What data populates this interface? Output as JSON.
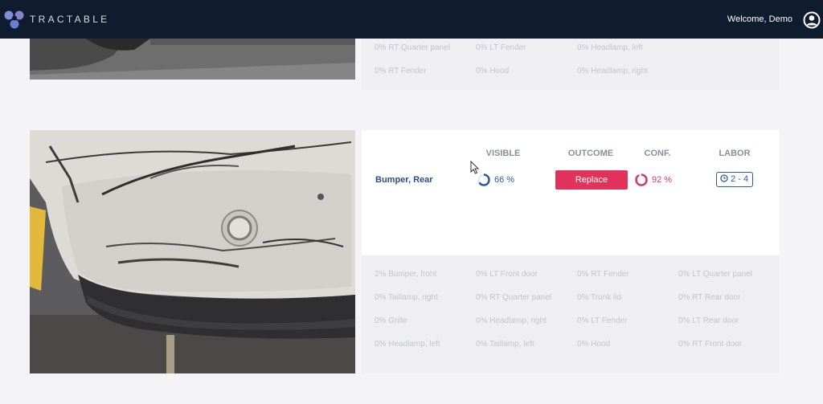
{
  "header": {
    "brand": "TRACTABLE",
    "welcome": "Welcome, Demo"
  },
  "card1": {
    "other_parts": [
      [
        "0% RT Quarter panel",
        "0% LT Fender",
        "0% Headlamp, left"
      ],
      [
        "0% RT Fender",
        "0% Hood",
        "0% Headlamp, right"
      ]
    ]
  },
  "card2": {
    "columns": {
      "visible": "VISIBLE",
      "outcome": "OUTCOME",
      "conf": "CONF.",
      "labor": "LABOR"
    },
    "part": "Bumper, Rear",
    "visible_pct": "66 %",
    "visible_value": 0.66,
    "outcome": "Replace",
    "conf_pct": "92 %",
    "conf_value": 0.92,
    "labor": "2 - 4",
    "other_parts": [
      [
        "2% Bumper, front",
        "0% LT Front door",
        "0% RT Fender",
        "0% LT Quarter panel"
      ],
      [
        "0% Taillamp, right",
        "0% RT Quarter panel",
        "0% Trunk lid",
        "0% RT Rear door"
      ],
      [
        "0% Grille",
        "0% Headlamp, right",
        "0% LT Fender",
        "0% LT Rear door"
      ],
      [
        "0% Headlamp, left",
        "0% Taillamp, left",
        "0% Hood",
        "0% RT Front door"
      ]
    ]
  },
  "colors": {
    "header_bg": "#0f1c2e",
    "accent_blue": "#2b5aa0",
    "replace_red": "#e0325b",
    "conf_ring": "#d23a6a"
  },
  "icons": {
    "logo": "tractable-logo-icon",
    "user": "user-circle-icon",
    "labor": "clock-icon",
    "cursor": "mouse-cursor-icon"
  }
}
